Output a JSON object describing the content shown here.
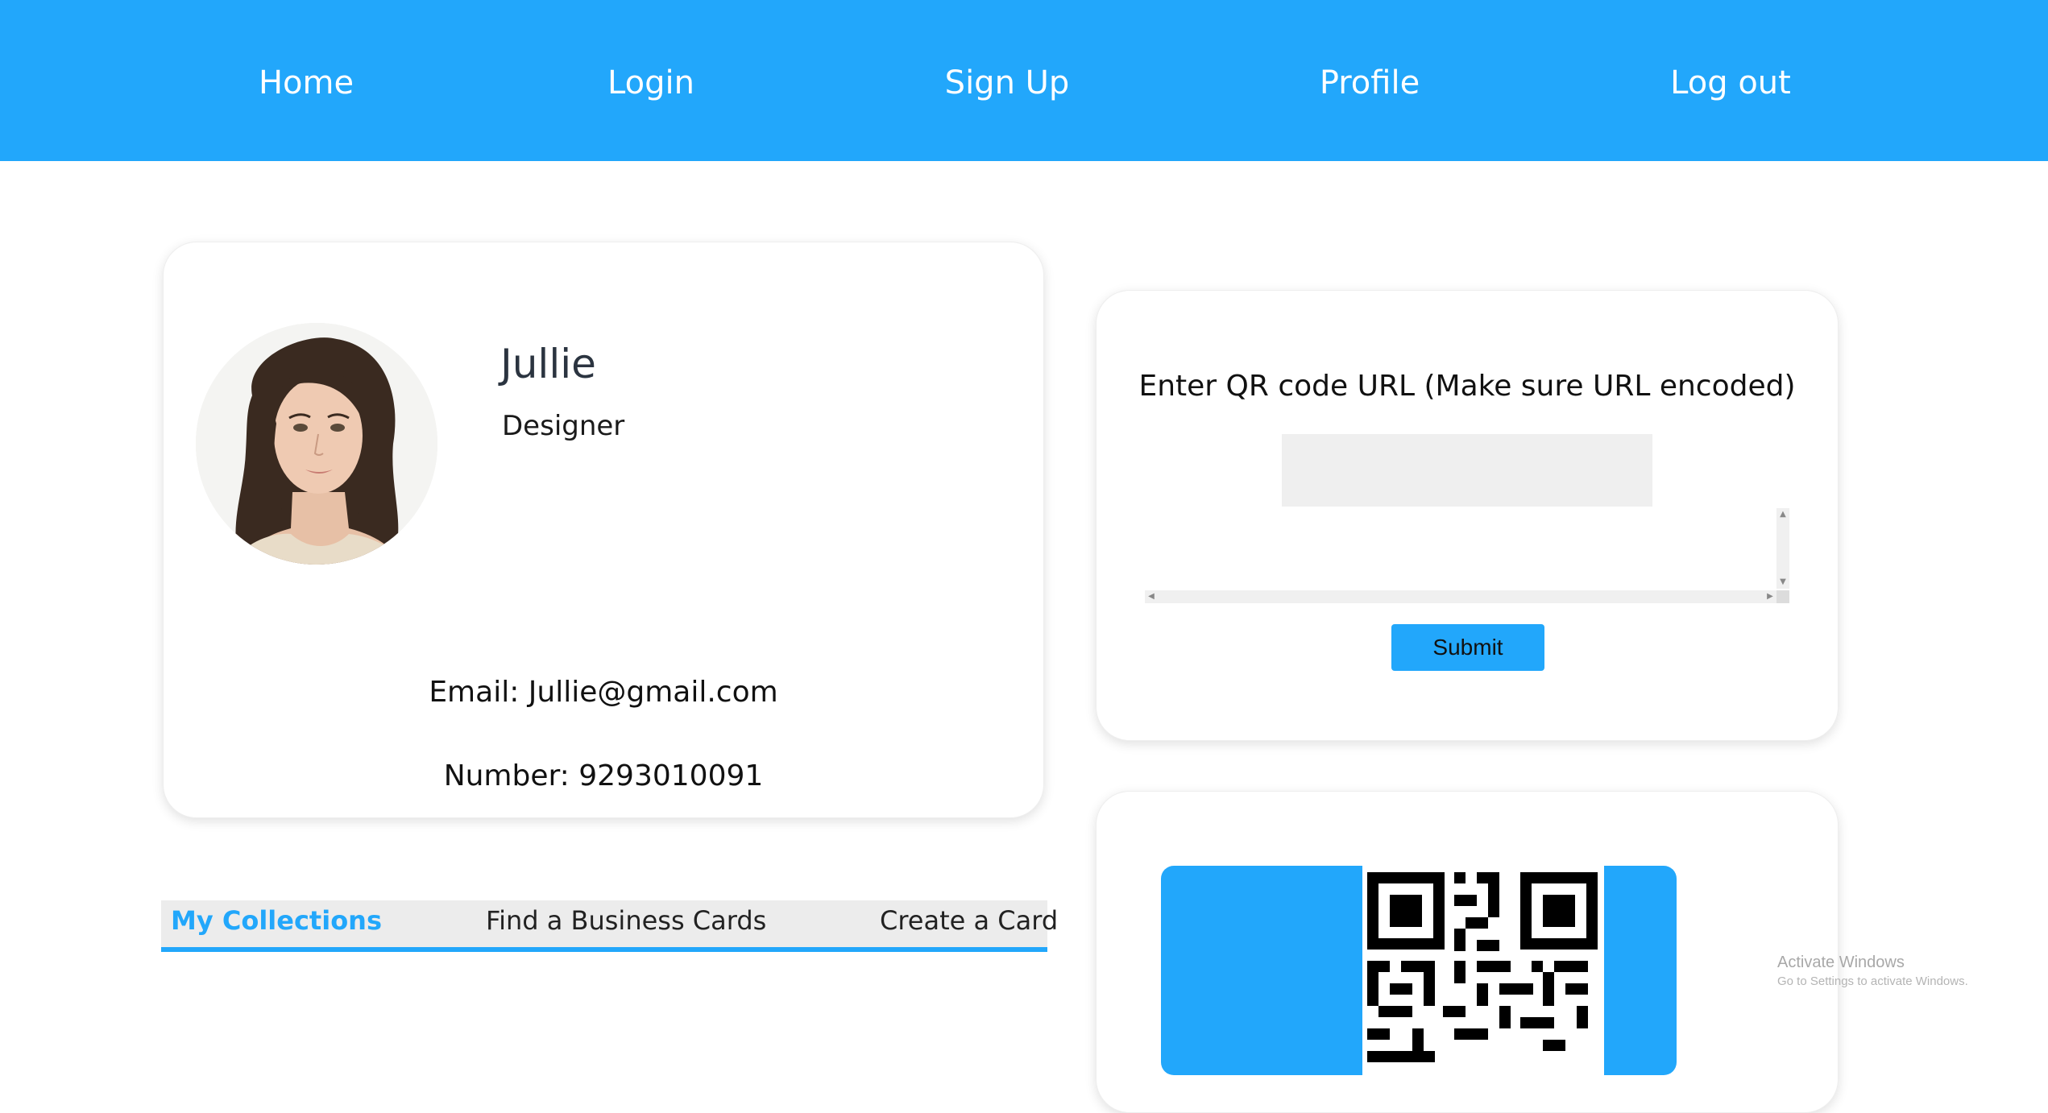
{
  "nav": {
    "items": [
      {
        "label": "Home"
      },
      {
        "label": "Login"
      },
      {
        "label": "Sign Up"
      },
      {
        "label": "Profile"
      },
      {
        "label": "Log out"
      }
    ]
  },
  "profile": {
    "name": "Jullie",
    "role": "Designer",
    "email": "Email: Jullie@gmail.com",
    "number": "Number: 9293010091",
    "avatar_icon": "avatar-photo"
  },
  "tabs": {
    "items": [
      {
        "label": "My Collections",
        "active": true
      },
      {
        "label": "Find a Business Cards",
        "active": false
      },
      {
        "label": "Create a Card",
        "active": false
      }
    ]
  },
  "qr_form": {
    "title": "Enter QR code URL (Make sure URL encoded)",
    "url_value": "",
    "submit_label": "Submit"
  },
  "qr_result": {
    "icon": "qr-code-icon"
  },
  "watermark": {
    "title": "Activate Windows",
    "subtitle": "Go to Settings to activate Windows."
  },
  "colors": {
    "accent": "#22a7fb",
    "background": "#ffffff",
    "tab_bar": "#ececec"
  }
}
